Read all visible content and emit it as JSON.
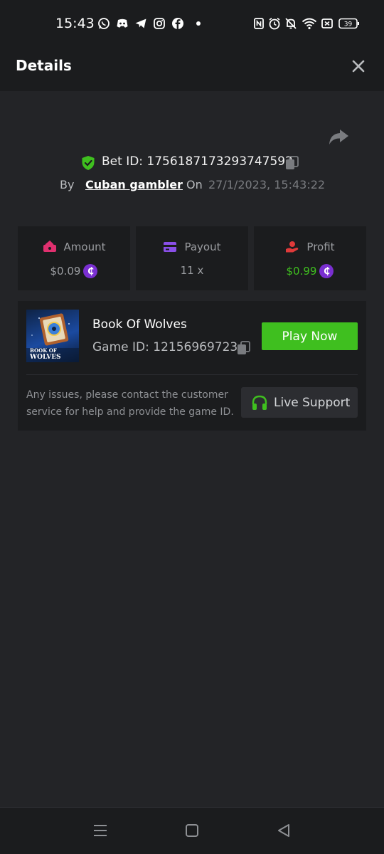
{
  "status_bar": {
    "time": "15:43",
    "battery": "39",
    "left_icons": [
      "whatsapp-icon",
      "discord-icon",
      "telegram-icon",
      "instagram-icon",
      "facebook-icon",
      "dot-icon"
    ],
    "right_icons": [
      "nfc-icon",
      "alarm-icon",
      "mute-icon",
      "wifi-icon",
      "sim-off-icon",
      "battery-icon"
    ]
  },
  "header": {
    "title": "Details"
  },
  "bet": {
    "id_text": "Bet ID: 1756187173293747592",
    "by_label": "By",
    "user": "Cuban gambler",
    "on_label": "On",
    "date": "27/1/2023, 15:43:22"
  },
  "stats": [
    {
      "label": "Amount",
      "value": "$0.09",
      "icon": "amount-icon",
      "coin": true,
      "value_color": "#9a9ca0"
    },
    {
      "label": "Payout",
      "value": "11 x",
      "icon": "payout-icon",
      "coin": false,
      "value_color": "#9a9ca0"
    },
    {
      "label": "Profit",
      "value": "$0.99",
      "icon": "profit-icon",
      "coin": true,
      "value_color": "#3fbf1f"
    }
  ],
  "coin_symbol": "₵",
  "game": {
    "name": "Book Of Wolves",
    "id_text": "Game ID: 12156969723",
    "play_label": "Play Now",
    "thumb_text_1": "BOOK OF",
    "thumb_text_2": "WOLVES"
  },
  "support": {
    "note": "Any issues, please contact the customer service for help and provide the game ID.",
    "button_label": "Live Support"
  },
  "colors": {
    "accent_green": "#3fbf1f",
    "coin_purple": "#7a2fd1",
    "background": "#232427",
    "card": "#1b1c1e"
  }
}
